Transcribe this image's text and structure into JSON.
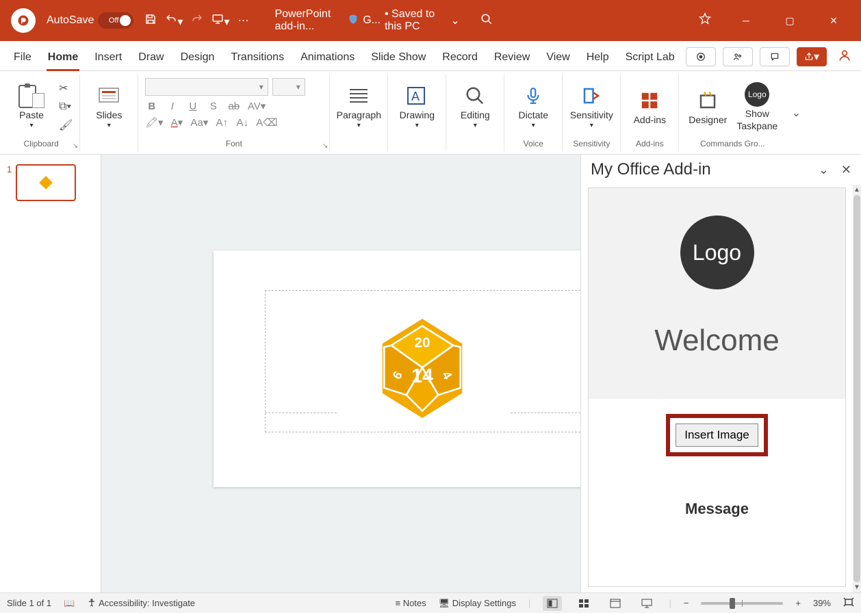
{
  "titlebar": {
    "autosave_label": "AutoSave",
    "autosave_state": "Off",
    "filename": "PowerPoint add-in...",
    "filename_suffix": "G...",
    "save_status": "• Saved to this PC"
  },
  "tabs": {
    "file": "File",
    "items": [
      "Home",
      "Insert",
      "Draw",
      "Design",
      "Transitions",
      "Animations",
      "Slide Show",
      "Record",
      "Review",
      "View",
      "Help",
      "Script Lab"
    ],
    "active_index": 0
  },
  "ribbon": {
    "clipboard": {
      "paste": "Paste",
      "label": "Clipboard"
    },
    "slides": {
      "slides": "Slides"
    },
    "font": {
      "label": "Font"
    },
    "paragraph": {
      "label": "Paragraph"
    },
    "drawing": {
      "label": "Drawing"
    },
    "editing": {
      "label": "Editing"
    },
    "dictate": {
      "label": "Dictate",
      "group": "Voice"
    },
    "sensitivity": {
      "label": "Sensitivity",
      "group": "Sensitivity"
    },
    "addins": {
      "label": "Add-ins",
      "group": "Add-ins"
    },
    "designer": {
      "label": "Designer"
    },
    "taskpane_btn": {
      "line1": "Show",
      "line2": "Taskpane"
    },
    "commands_group": "Commands Gro..."
  },
  "thumbnails": {
    "items": [
      {
        "number": "1"
      }
    ]
  },
  "taskpane": {
    "title": "My Office Add-in",
    "logo_text": "Logo",
    "welcome": "Welcome",
    "insert_button": "Insert Image",
    "message": "Message"
  },
  "statusbar": {
    "slide": "Slide 1 of 1",
    "accessibility": "Accessibility: Investigate",
    "notes": "Notes",
    "display_settings": "Display Settings",
    "zoom": "39%"
  }
}
